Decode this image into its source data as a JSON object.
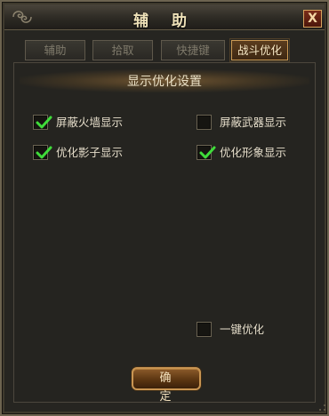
{
  "window": {
    "title": "辅 助",
    "close_label": "X"
  },
  "tabs": [
    {
      "label": "辅助",
      "active": false
    },
    {
      "label": "拾取",
      "active": false
    },
    {
      "label": "快捷键",
      "active": false
    },
    {
      "label": "战斗优化",
      "active": true
    }
  ],
  "section": {
    "title": "显示优化设置"
  },
  "options": {
    "hide_fire_wall": {
      "label": "屏蔽火墙显示",
      "checked": true
    },
    "hide_weapon": {
      "label": "屏蔽武器显示",
      "checked": false
    },
    "optimize_shadow": {
      "label": "优化影子显示",
      "checked": true
    },
    "optimize_appearance": {
      "label": "优化形象显示",
      "checked": true
    },
    "one_click_optimize": {
      "label": "一键优化",
      "checked": false
    }
  },
  "confirm": {
    "label": "确 定"
  },
  "colors": {
    "check_green": "#3fdc3a",
    "accent_gold": "#cb9a55",
    "close_red": "#6e2412"
  }
}
